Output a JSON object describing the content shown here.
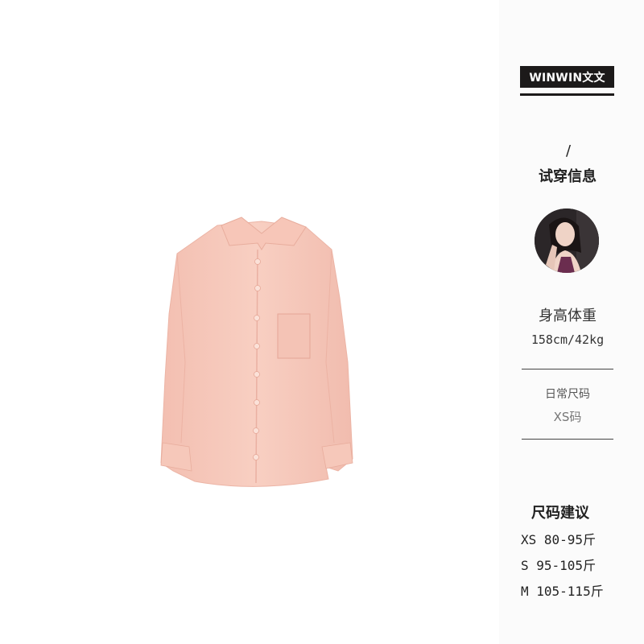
{
  "brand": {
    "name": "WINWIN文文"
  },
  "tryon": {
    "slash": "/",
    "title": "试穿信息",
    "height_weight_label": "身高体重",
    "height_weight_value": "158cm/42kg",
    "usual_size_label": "日常尺码",
    "usual_size_value": "XS码"
  },
  "size_advice": {
    "title": "尺码建议",
    "rows": [
      "XS 80-95斤",
      "S 95-105斤",
      "M 105-115斤"
    ]
  },
  "colors": {
    "shirt": "#f7c9bb",
    "badge": "#1c1a1a",
    "panel_bg": "#fbfbfb"
  }
}
